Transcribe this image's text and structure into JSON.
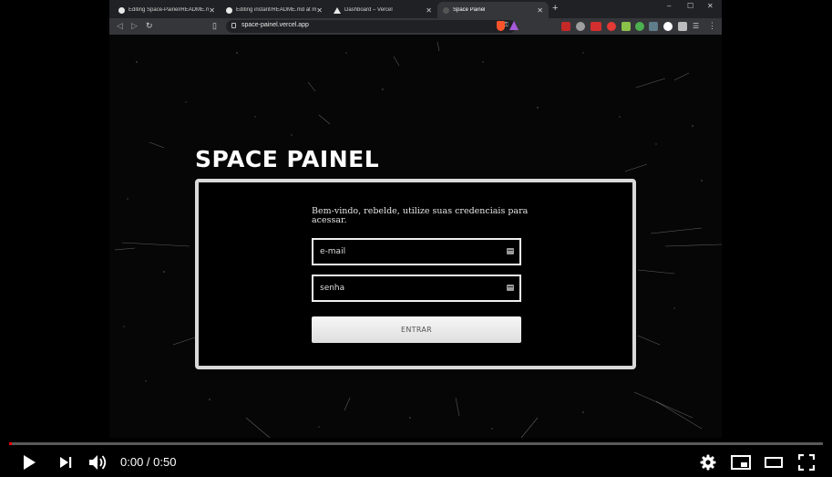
{
  "browser": {
    "tabs": [
      {
        "label": "Editing Space-Painel/README.md at ...",
        "icon": "github-icon"
      },
      {
        "label": "Editing instant/README.md at ma...",
        "icon": "github-icon"
      },
      {
        "label": "Dashboard – Vercel",
        "icon": "vercel-icon"
      },
      {
        "label": "Space Painel",
        "icon": "space-icon"
      }
    ],
    "new_tab": "+",
    "url": "space-painel.vercel.app"
  },
  "page": {
    "brand": "SPACE PAINEL",
    "welcome": "Bem-vindo, rebelde, utilize suas credenciais para acessar.",
    "email_placeholder": "e-mail",
    "password_placeholder": "senha",
    "submit_label": "ENTRAR"
  },
  "player": {
    "time": "0:00 / 0:50",
    "progress_fraction": 0.0,
    "colors": {
      "progress": "#ff0000"
    }
  }
}
